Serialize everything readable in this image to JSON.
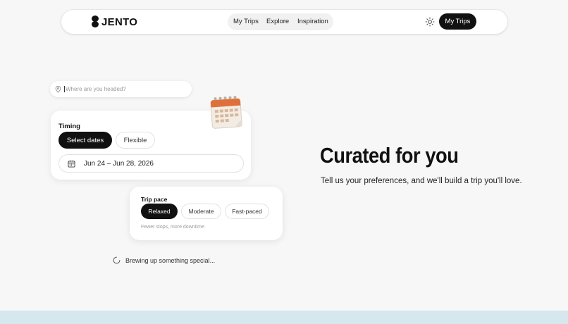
{
  "brand": {
    "name": "JENTO"
  },
  "nav": {
    "links": [
      "My Trips",
      "Explore",
      "Inspiration"
    ],
    "theme_icon": "sun-icon",
    "cta_label": "My Trips"
  },
  "search": {
    "placeholder": "Where are you headed?",
    "value": ""
  },
  "timing": {
    "title": "Timing",
    "options": [
      "Select dates",
      "Flexible"
    ],
    "selected": "Select dates",
    "date_range": "Jun 24 – Jun 28, 2026"
  },
  "pace": {
    "title": "Trip pace",
    "options": [
      "Relaxed",
      "Moderate",
      "Fast-paced"
    ],
    "selected": "Relaxed",
    "hint": "Fewer stops, more downtime"
  },
  "loading": {
    "text": "Brewing up something special..."
  },
  "hero": {
    "title": "Curated for you",
    "subtitle": "Tell us your preferences, and we'll build a trip you'll love."
  },
  "colors": {
    "background": "#f7f7f7",
    "primary_dark": "#111111",
    "calendar_accent": "#e0703a",
    "bottom_band": "#d6e7ee"
  }
}
